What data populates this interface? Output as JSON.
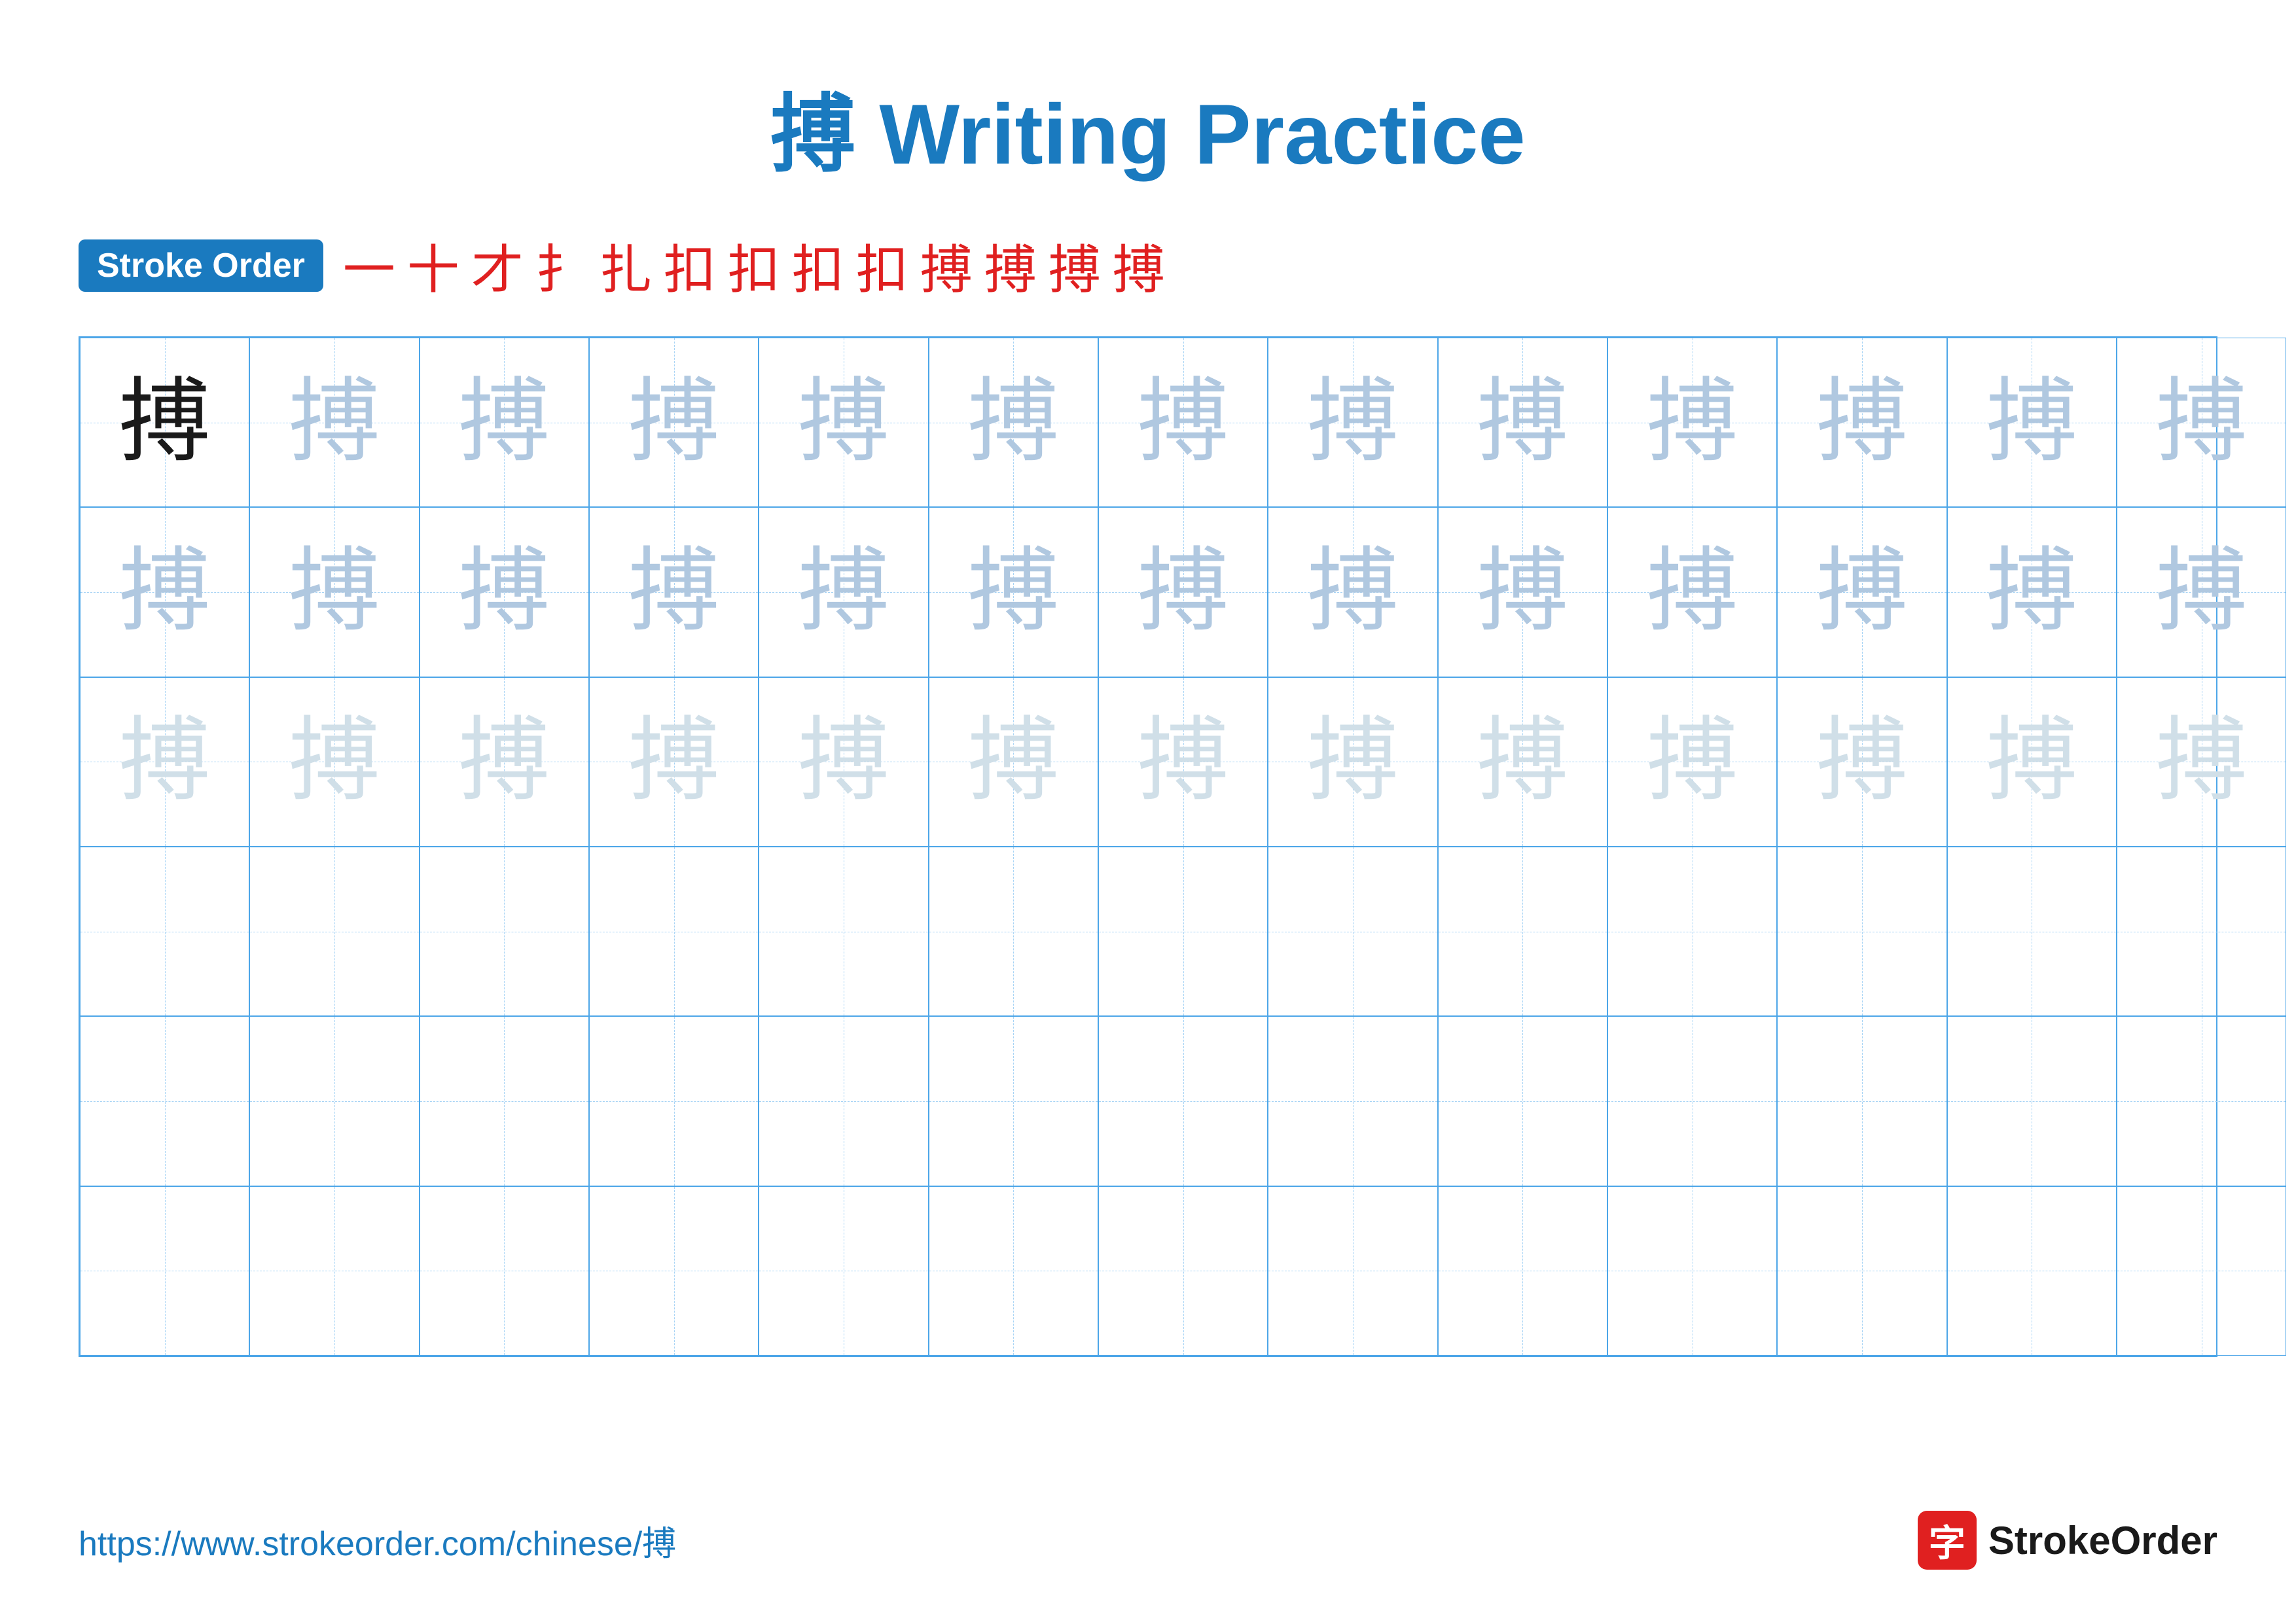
{
  "title": {
    "text": "搏 Writing Practice",
    "char": "搏",
    "label": "Writing Practice"
  },
  "stroke_order": {
    "badge_label": "Stroke Order",
    "strokes": [
      "一",
      "十",
      "才",
      "扌",
      "扎",
      "扣",
      "扣",
      "扣",
      "扣",
      "搏",
      "搏",
      "搏",
      "搏"
    ]
  },
  "grid": {
    "rows": 6,
    "cols": 13,
    "char": "搏"
  },
  "footer": {
    "url": "https://www.strokeorder.com/chinese/搏",
    "logo_char": "字",
    "logo_text": "StrokeOrder"
  }
}
